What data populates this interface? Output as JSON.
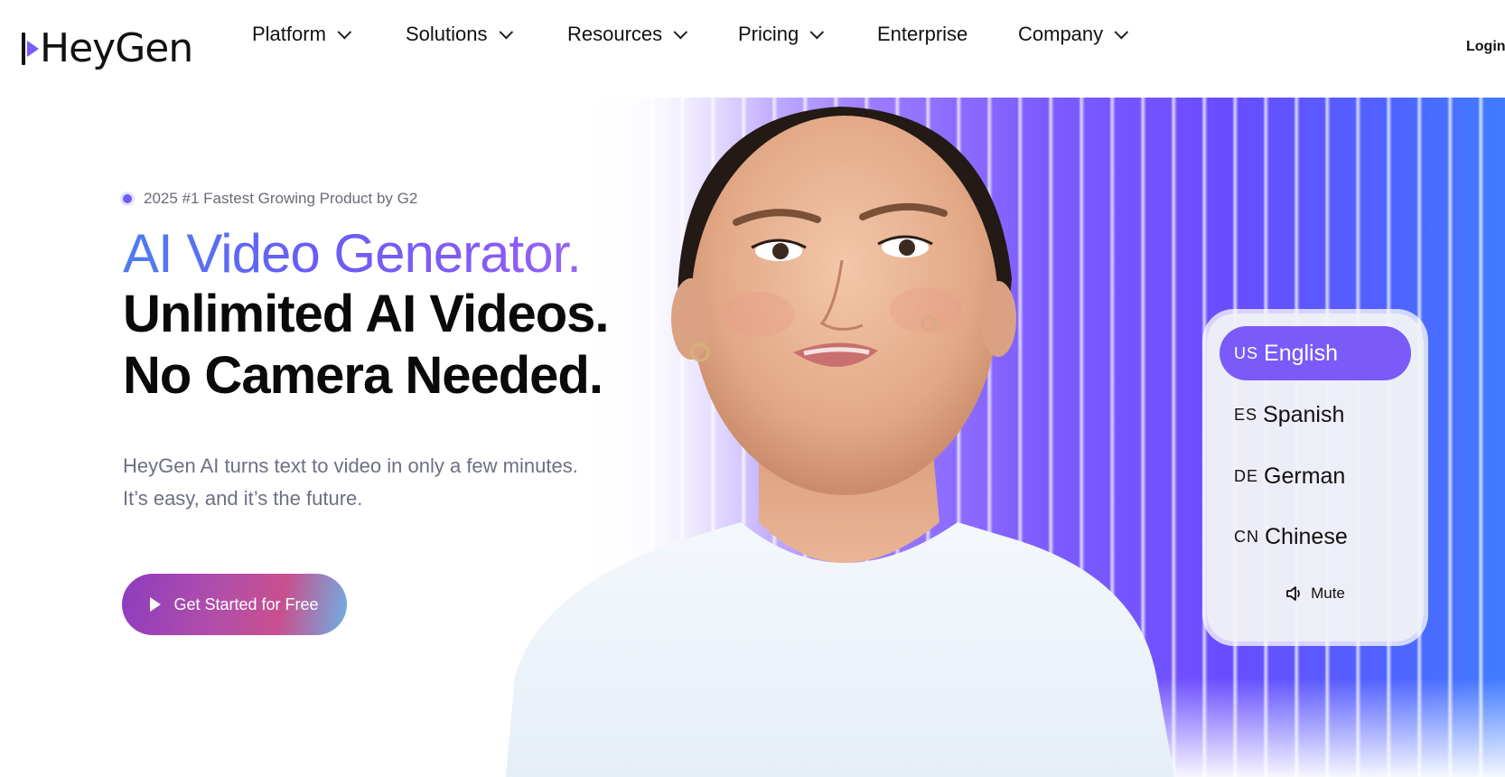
{
  "brand": {
    "name": "HeyGen",
    "accent": "#7a5af8"
  },
  "nav": {
    "items": [
      {
        "label": "Platform",
        "has_dropdown": true
      },
      {
        "label": "Solutions",
        "has_dropdown": true
      },
      {
        "label": "Resources",
        "has_dropdown": true
      },
      {
        "label": "Pricing",
        "has_dropdown": true
      },
      {
        "label": "Enterprise",
        "has_dropdown": false
      },
      {
        "label": "Company",
        "has_dropdown": true
      }
    ],
    "login_label": "Login"
  },
  "hero": {
    "badge": "2025 #1 Fastest Growing Product by G2",
    "headline_gradient": "AI Video Generator.",
    "headline_line2": "Unlimited AI Videos.",
    "headline_line3": "No Camera Needed.",
    "subtext_line1": "HeyGen AI turns text to video in only a few minutes.",
    "subtext_line2": "It’s easy, and it’s the future.",
    "cta_label": "Get Started for Free",
    "cta_icon": "play-icon"
  },
  "language_panel": {
    "languages": [
      {
        "code": "US",
        "label": "English",
        "selected": true
      },
      {
        "code": "ES",
        "label": "Spanish",
        "selected": false
      },
      {
        "code": "DE",
        "label": "German",
        "selected": false
      },
      {
        "code": "CN",
        "label": "Chinese",
        "selected": false
      }
    ],
    "mute_label": "Mute",
    "mute_icon": "speaker-icon"
  },
  "colors": {
    "headline_gradient": [
      "#4f7cf0",
      "#9b6cf3"
    ],
    "background_stripes": [
      "#9a7bff",
      "#3f7dff"
    ],
    "cta_gradient": [
      "#8e3dbf",
      "#6fb0e3"
    ]
  }
}
